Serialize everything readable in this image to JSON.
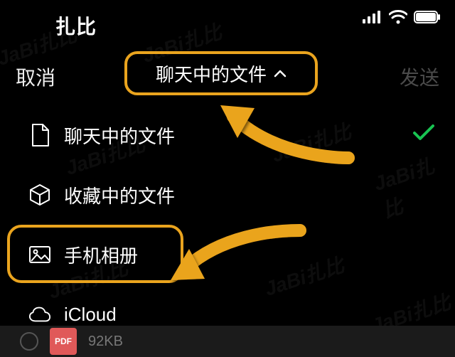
{
  "status": {
    "title": "扎比"
  },
  "nav": {
    "cancel": "取消",
    "title": "聊天中的文件",
    "send": "发送"
  },
  "list": [
    {
      "icon": "file-icon",
      "label": "聊天中的文件",
      "selected": true
    },
    {
      "icon": "cube-icon",
      "label": "收藏中的文件",
      "selected": false
    },
    {
      "icon": "photo-icon",
      "label": "手机相册",
      "selected": false
    },
    {
      "icon": "cloud-icon",
      "label": "iCloud",
      "selected": false
    }
  ],
  "footer": {
    "badge": "PDF",
    "size": "92KB"
  },
  "annotations": {
    "highlight_color": "#eaa41e",
    "highlighted": [
      "source-dropdown",
      "source-item-photo-album"
    ],
    "arrows": 2
  },
  "watermark": "JaBi扎比"
}
